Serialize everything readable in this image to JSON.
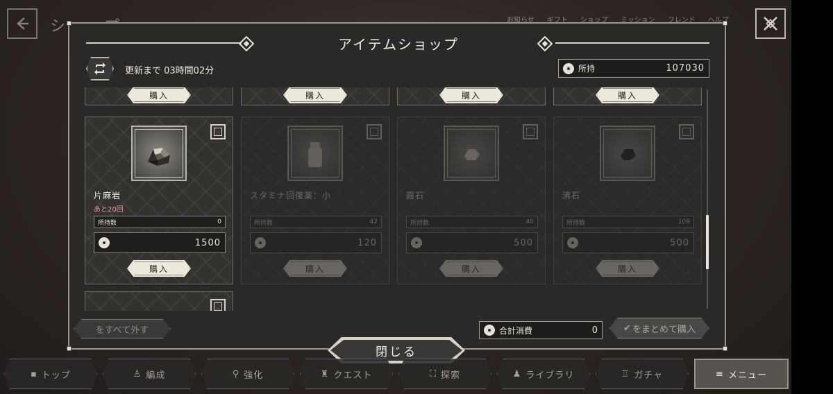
{
  "screen": {
    "title": "ショップ",
    "top_nav": [
      "お知らせ",
      "ギフト",
      "ショップ",
      "ミッション",
      "フレンド",
      "ヘルプ"
    ]
  },
  "modal": {
    "title": "アイテムショップ",
    "refresh_text": "更新まで 03時間02分",
    "owned_label": "所持",
    "owned_value": "107030",
    "total_label": "合計消費",
    "total_value": "0",
    "clear_all_label": "をすべて外す",
    "bulk_buy_label": "をまとめて購入",
    "close_label": "閉じる"
  },
  "buy_label": "購入",
  "items": [
    {
      "name": "片麻岩",
      "remaining": "あと20回",
      "held_label": "所持数",
      "held": "0",
      "price": "1500",
      "enabled": true
    },
    {
      "name": "スタミナ回復薬：小",
      "remaining": "",
      "held_label": "所持数",
      "held": "42",
      "price": "120",
      "enabled": false
    },
    {
      "name": "霞石",
      "remaining": "",
      "held_label": "所持数",
      "held": "40",
      "price": "500",
      "enabled": false
    },
    {
      "name": "沸石",
      "remaining": "",
      "held_label": "所持数",
      "held": "109",
      "price": "500",
      "enabled": false
    }
  ],
  "bottom_nav": [
    {
      "label": "トップ",
      "active": false
    },
    {
      "label": "編成",
      "active": false
    },
    {
      "label": "強化",
      "active": false
    },
    {
      "label": "クエスト",
      "active": false
    },
    {
      "label": "探索",
      "active": false
    },
    {
      "label": "ライブラリ",
      "active": false
    },
    {
      "label": "ガチャ",
      "active": false
    },
    {
      "label": "メニュー",
      "active": true
    }
  ],
  "icons": {
    "back": "back-arrow-icon",
    "close": "close-x-icon",
    "refresh": "refresh-icon",
    "coin": "coin-icon"
  }
}
